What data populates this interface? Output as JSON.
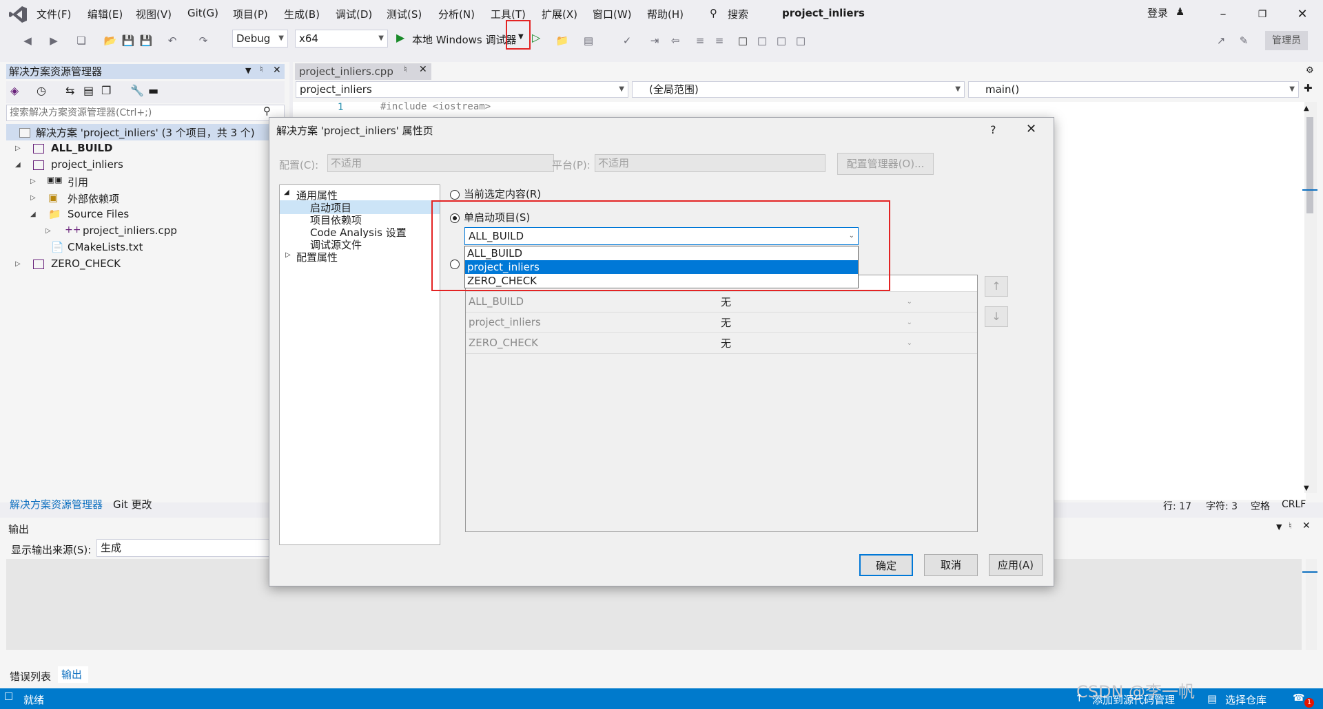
{
  "menu": {
    "items": [
      "文件(F)",
      "编辑(E)",
      "视图(V)",
      "Git(G)",
      "项目(P)",
      "生成(B)",
      "调试(D)",
      "测试(S)",
      "分析(N)",
      "工具(T)",
      "扩展(X)",
      "窗口(W)",
      "帮助(H)"
    ],
    "search_label": "搜索",
    "project_title": "project_inliers",
    "login": "登录"
  },
  "toolbar": {
    "config": "Debug",
    "platform": "x64",
    "run_label": "本地 Windows 调试器",
    "admin": "管理员"
  },
  "solution_explorer": {
    "title": "解决方案资源管理器",
    "search_placeholder": "搜索解决方案资源管理器(Ctrl+;)",
    "solution": "解决方案 'project_inliers' (3 个项目，共 3 个)",
    "items": [
      "ALL_BUILD",
      "project_inliers",
      "引用",
      "外部依赖项",
      "Source Files",
      "project_inliers.cpp",
      "CMakeLists.txt",
      "ZERO_CHECK"
    ],
    "tab_active": "解决方案资源管理器",
    "tab_git": "Git 更改"
  },
  "editor": {
    "tab": "project_inliers.cpp",
    "nav_project": "project_inliers",
    "nav_scope": "(全局范围)",
    "nav_func": "main()",
    "line_no": "1",
    "code_line": "#include <iostream>"
  },
  "status_right": {
    "line": "行: 17",
    "char": "字符: 3",
    "space": "空格",
    "eol": "CRLF"
  },
  "output": {
    "title": "输出",
    "source_label": "显示输出来源(S):",
    "source_value": "生成",
    "tab_errors": "错误列表",
    "tab_output": "输出"
  },
  "statusbar": {
    "ready": "就绪",
    "add_source": "添加到源代码管理",
    "select_repo": "选择仓库",
    "badge": "1"
  },
  "dialog": {
    "title": "解决方案 'project_inliers' 属性页",
    "help": "?",
    "config_label": "配置(C):",
    "config_value": "不适用",
    "platform_label": "平台(P):",
    "platform_value": "不适用",
    "config_manager": "配置管理器(O)...",
    "nav": [
      "通用属性",
      "启动项目",
      "项目依赖项",
      "Code Analysis 设置",
      "调试源文件",
      "配置属性"
    ],
    "radio_current": "当前选定内容(R)",
    "radio_single": "单启动项目(S)",
    "selected_project": "ALL_BUILD",
    "dropdown_options": [
      "ALL_BUILD",
      "project_inliers",
      "ZERO_CHECK"
    ],
    "grid_rows": [
      {
        "project": "ALL_BUILD",
        "action": "无"
      },
      {
        "project": "project_inliers",
        "action": "无"
      },
      {
        "project": "ZERO_CHECK",
        "action": "无"
      }
    ],
    "ok": "确定",
    "cancel": "取消",
    "apply": "应用(A)"
  },
  "watermark": "CSDN @李一帆"
}
